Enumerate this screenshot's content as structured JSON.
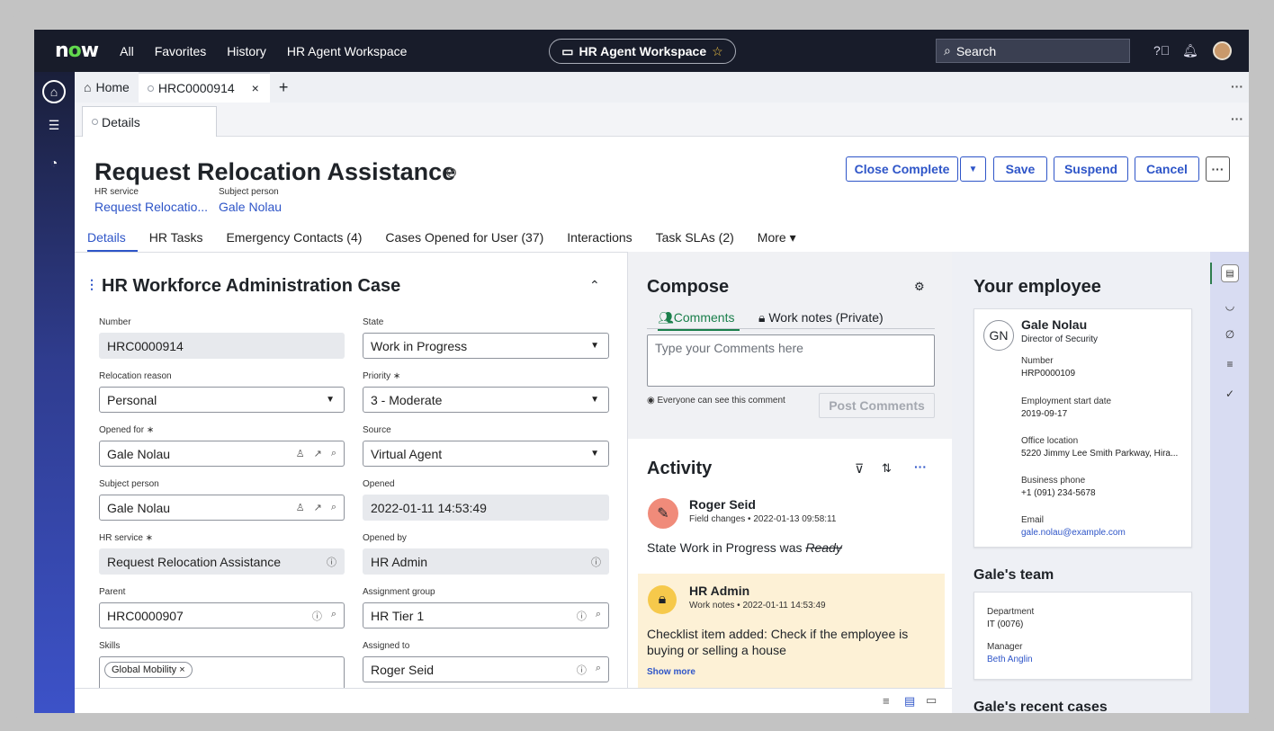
{
  "topbar": {
    "logo": "now",
    "nav": [
      "All",
      "Favorites",
      "History",
      "HR Agent Workspace"
    ],
    "workspace_pill": "HR Agent Workspace",
    "search_placeholder": "Search"
  },
  "tabs": {
    "home": "Home",
    "case": "HRC0000914",
    "close": "×",
    "add": "+"
  },
  "subtab": {
    "label": "Details"
  },
  "record": {
    "title": "Request Relocation Assistance",
    "hr_service_label": "HR service",
    "hr_service_value": "Request Relocatio...",
    "subject_label": "Subject person",
    "subject_value": "Gale Nolau"
  },
  "actions": {
    "close_complete": "Close Complete",
    "save": "Save",
    "suspend": "Suspend",
    "cancel": "Cancel",
    "more": "···"
  },
  "form_tabs": [
    "Details",
    "HR Tasks",
    "Emergency Contacts (4)",
    "Cases Opened for User (37)",
    "Interactions",
    "Task SLAs (2)",
    "More ▾"
  ],
  "form": {
    "section_title": "HR Workforce Administration Case",
    "number_label": "Number",
    "number": "HRC0000914",
    "state_label": "State",
    "state": "Work in Progress",
    "reloc_label": "Relocation reason",
    "reloc": "Personal",
    "priority_label": "Priority ∗",
    "priority": "3 - Moderate",
    "opened_for_label": "Opened for ∗",
    "opened_for": "Gale Nolau",
    "source_label": "Source",
    "source": "Virtual Agent",
    "subject_label": "Subject person",
    "subject": "Gale Nolau",
    "opened_label": "Opened",
    "opened": "2022-01-11 14:53:49",
    "hrservice_label": "HR service ∗",
    "hrservice": "Request Relocation Assistance",
    "openedby_label": "Opened by",
    "openedby": "HR Admin",
    "parent_label": "Parent",
    "parent": "HRC0000907",
    "group_label": "Assignment group",
    "group": "HR Tier 1",
    "skills_label": "Skills",
    "skill_chip": "Global Mobility ×",
    "assigned_label": "Assigned to",
    "assigned": "Roger Seid"
  },
  "compose": {
    "title": "Compose",
    "tab_comments": "Comments",
    "tab_worknotes": "Work notes (Private)",
    "placeholder": "Type your Comments here",
    "visibility": "Everyone can see this comment",
    "post": "Post Comments"
  },
  "activity": {
    "title": "Activity",
    "entry1_name": "Roger Seid",
    "entry1_meta": "Field changes • 2022-01-13 09:58:11",
    "entry1_field": "State",
    "entry1_text": "Work in Progress was",
    "entry1_old": "Ready",
    "entry2_name": "HR Admin",
    "entry2_meta": "Work notes • 2022-01-11 14:53:49",
    "entry2_text": "Checklist item added: Check if the employee is buying or selling a house",
    "show_more": "Show more"
  },
  "employee": {
    "title": "Your employee",
    "initials": "GN",
    "name": "Gale Nolau",
    "role": "Director of Security",
    "number_label": "Number",
    "number": "HRP0000109",
    "start_label": "Employment start date",
    "start": "2019-09-17",
    "office_label": "Office location",
    "office": "5220 Jimmy Lee Smith Parkway, Hira...",
    "phone_label": "Business phone",
    "phone": "+1 (091) 234-5678",
    "email_label": "Email",
    "email": "gale.nolau@example.com"
  },
  "team": {
    "title": "Gale's team",
    "dept_label": "Department",
    "dept": "IT (0076)",
    "mgr_label": "Manager",
    "mgr": "Beth Anglin"
  },
  "recent": {
    "title": "Gale's recent cases"
  },
  "colors": {
    "accent": "#2e55c8",
    "topbar": "#181c2a",
    "note_bg": "#fdf1d6",
    "logo_o": "#62d84e"
  }
}
